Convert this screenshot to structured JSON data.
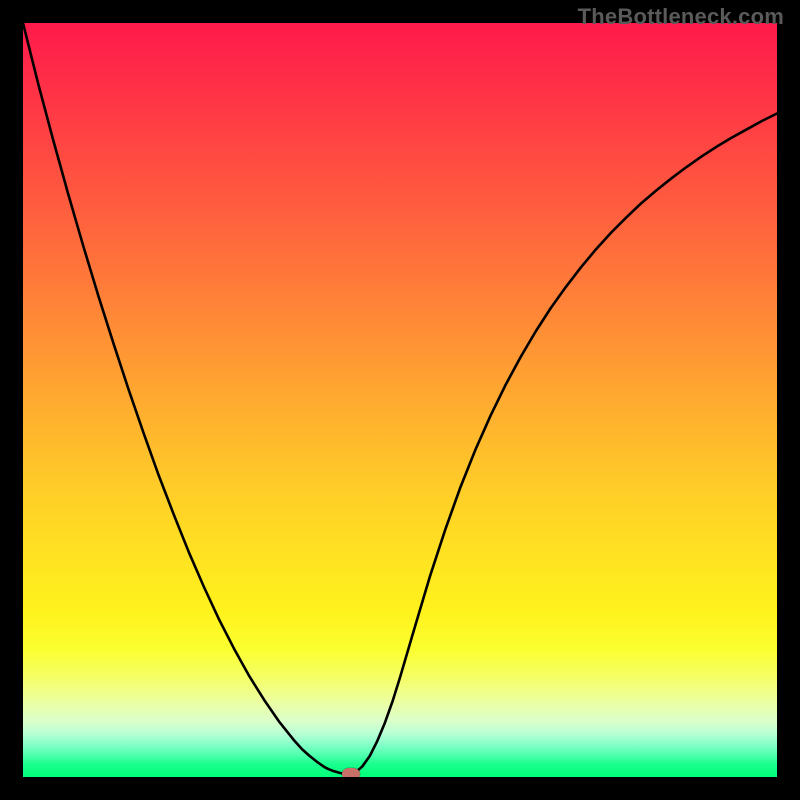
{
  "watermark": "TheBottleneck.com",
  "chart_data": {
    "type": "line",
    "title": "",
    "xlabel": "",
    "ylabel": "",
    "xlim": [
      0,
      1
    ],
    "ylim": [
      0,
      1
    ],
    "x": [
      0.0,
      0.02,
      0.04,
      0.06,
      0.08,
      0.1,
      0.12,
      0.14,
      0.16,
      0.18,
      0.2,
      0.22,
      0.24,
      0.26,
      0.28,
      0.3,
      0.32,
      0.34,
      0.36,
      0.37,
      0.38,
      0.39,
      0.4,
      0.405,
      0.41,
      0.415,
      0.42,
      0.425,
      0.43,
      0.435,
      0.44,
      0.445,
      0.45,
      0.46,
      0.47,
      0.48,
      0.49,
      0.5,
      0.52,
      0.54,
      0.56,
      0.58,
      0.6,
      0.62,
      0.64,
      0.66,
      0.68,
      0.7,
      0.72,
      0.74,
      0.76,
      0.78,
      0.8,
      0.82,
      0.84,
      0.86,
      0.88,
      0.9,
      0.92,
      0.94,
      0.96,
      0.98,
      1.0
    ],
    "values": [
      1.0,
      0.92,
      0.845,
      0.773,
      0.704,
      0.638,
      0.575,
      0.514,
      0.456,
      0.4,
      0.348,
      0.298,
      0.252,
      0.209,
      0.17,
      0.134,
      0.102,
      0.073,
      0.048,
      0.037,
      0.028,
      0.02,
      0.013,
      0.0105,
      0.0085,
      0.007,
      0.0055,
      0.0045,
      0.004,
      0.0042,
      0.006,
      0.0095,
      0.014,
      0.028,
      0.048,
      0.072,
      0.1,
      0.132,
      0.2,
      0.267,
      0.328,
      0.384,
      0.434,
      0.479,
      0.52,
      0.557,
      0.591,
      0.622,
      0.65,
      0.676,
      0.7,
      0.722,
      0.742,
      0.761,
      0.778,
      0.794,
      0.809,
      0.823,
      0.836,
      0.848,
      0.859,
      0.87,
      0.88
    ],
    "marker": {
      "x": 0.435,
      "y": 0.004
    },
    "colors": {
      "curve": "#000000",
      "marker": "#c77168",
      "gradient_top": "#ff1a4b",
      "gradient_bottom": "#00ff79"
    }
  }
}
